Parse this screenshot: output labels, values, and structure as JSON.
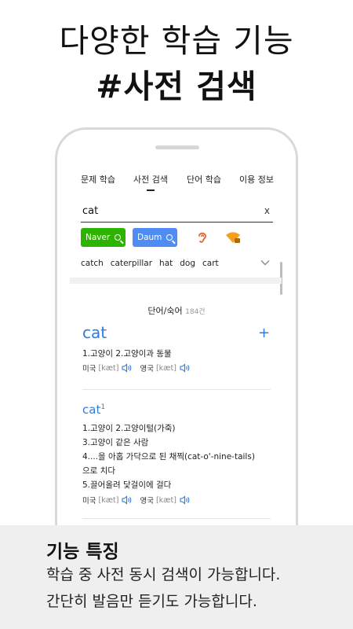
{
  "headline": {
    "line1": "다양한 학습 기능",
    "line2": "#사전 검색"
  },
  "nav": {
    "tabs": [
      {
        "label": "문제 학습"
      },
      {
        "label": "사전 검색",
        "active": true
      },
      {
        "label": "단어 학습"
      },
      {
        "label": "이용 정보"
      }
    ]
  },
  "search": {
    "value": "cat",
    "clear_label": "x"
  },
  "engines": [
    {
      "label": "Naver",
      "color": "#2db400"
    },
    {
      "label": "Daum",
      "color": "#4f8df4"
    }
  ],
  "icons": {
    "listen": "ear-icon",
    "wifi": "wifi-icon",
    "expand": "chevron-down-icon",
    "speaker": "speaker-icon",
    "add": "plus-icon"
  },
  "suggestions": [
    "catch",
    "caterpillar",
    "hat",
    "dog",
    "cart"
  ],
  "results_header": {
    "label": "단어/숙어",
    "count": "184건"
  },
  "entries": [
    {
      "word": "cat",
      "add_label": "+",
      "meanings": [
        "1.고양이    2.고양이과 동물"
      ],
      "pron": {
        "us_label": "미국",
        "us_ipa": "[kæt]",
        "uk_label": "영국",
        "uk_ipa": "[kæt]"
      }
    },
    {
      "word": "cat",
      "superscript": "1",
      "meanings": [
        "1.고양이    2.고양이털(가죽)",
        "3.고양이 같은 사람",
        "4....을 아홉 가닥으로 된 채찍(cat-o'-nine-tails)",
        "으로 치다",
        "5.끌어올려 닻걸이에 걸다"
      ],
      "pron": {
        "us_label": "미국",
        "us_ipa": "[kæt]",
        "uk_label": "영국",
        "uk_ipa": "[kæt]"
      }
    }
  ],
  "footer": {
    "title": "기능 특징",
    "lines": [
      "학습 중 사전 동시 검색이 가능합니다.",
      "간단히 발음만 듣기도 가능합니다."
    ]
  },
  "colors": {
    "accent": "#2c7be5",
    "highlight": "#f5e100",
    "ear": "#e8622c",
    "wifi": "#f2a01e"
  }
}
